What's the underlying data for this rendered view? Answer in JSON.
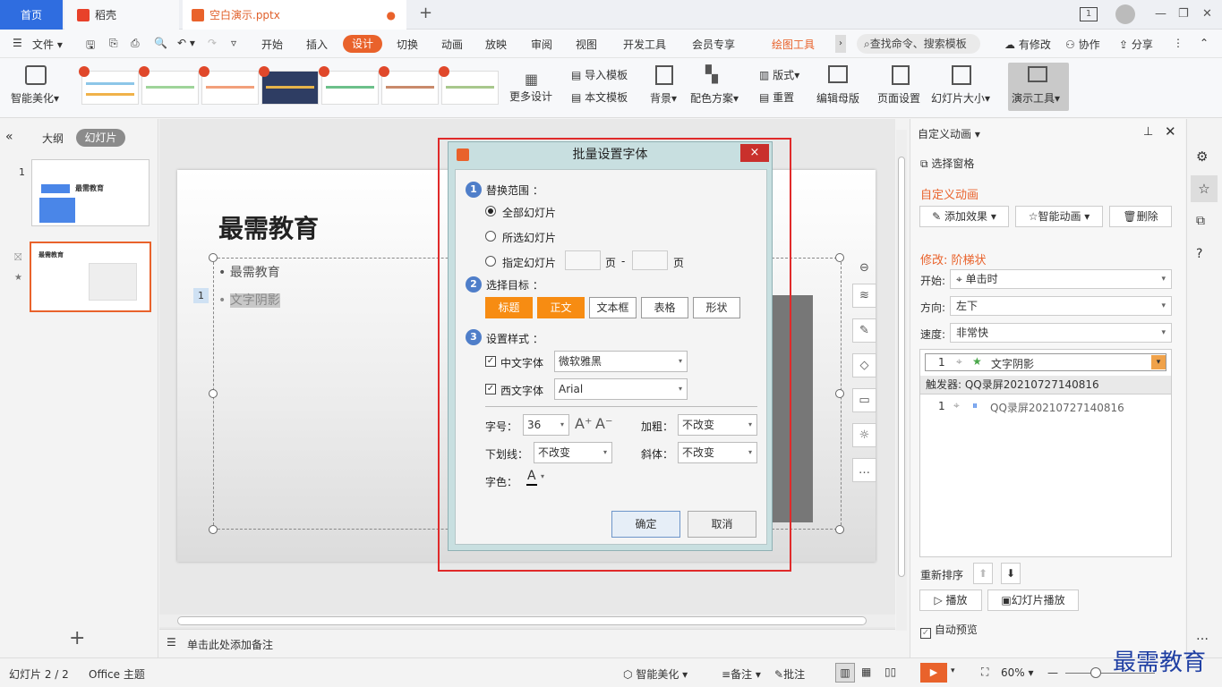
{
  "tabs": {
    "home": "首页",
    "daoke": "稻壳",
    "file": "空白演示.pptx",
    "add": "+"
  },
  "window": {
    "badge": "1"
  },
  "menu": {
    "file": "文件",
    "items": [
      "开始",
      "插入",
      "设计",
      "切换",
      "动画",
      "放映",
      "审阅",
      "视图",
      "开发工具",
      "会员专享"
    ],
    "drawing_tools": "绘图工具",
    "search": "查找命令、搜索模板",
    "modified": "有修改",
    "collab": "协作",
    "share": "分享"
  },
  "ribbon": {
    "smart_beautify": "智能美化",
    "more_design": "更多设计",
    "import_template": "导入模板",
    "this_template": "本文模板",
    "background": "背景",
    "color_scheme": "配色方案",
    "layout": "版式",
    "reset": "重置",
    "edit_master": "编辑母版",
    "page_setup": "页面设置",
    "slide_size": "幻灯片大小",
    "present_tools": "演示工具"
  },
  "left": {
    "outline": "大纲",
    "slides": "幻灯片",
    "slide1_num": "1",
    "slide1_title": "最需教育",
    "slide2_title": "最需教育"
  },
  "slide": {
    "title": "最需教育",
    "bullet1": "最需教育",
    "bullet2": "文字阴影",
    "anim_tag": "1"
  },
  "notes": "单击此处添加备注",
  "dialog": {
    "title": "批量设置字体",
    "close": "×",
    "scope": {
      "num": "1",
      "label": "替换范围 ：",
      "all": "全部幻灯片",
      "selected": "所选幻灯片",
      "specified": "指定幻灯片",
      "page": "页",
      "dash": "-"
    },
    "target": {
      "num": "2",
      "label": "选择目标 ：",
      "items": [
        "标题",
        "正文",
        "文本框",
        "表格",
        "形状"
      ]
    },
    "style": {
      "num": "3",
      "label": "设置样式 ：",
      "cn_font_label": "中文字体",
      "cn_font": "微软雅黑",
      "en_font_label": "西文字体",
      "en_font": "Arial",
      "size_label": "字号：",
      "size": "36",
      "grow": "A⁺",
      "shrink": "A⁻",
      "bold_label": "加粗：",
      "bold": "不改变",
      "underline_label": "下划线：",
      "underline": "不改变",
      "italic_label": "斜体：",
      "italic": "不改变",
      "color_label": "字色："
    },
    "ok": "确定",
    "cancel": "取消"
  },
  "right": {
    "header": "自定义动画",
    "select_pane": "选择窗格",
    "section": "自定义动画",
    "add_effect": "添加效果",
    "smart_anim": "智能动画",
    "delete": "删除",
    "modify": "修改: 阶梯状",
    "start_label": "开始:",
    "start": "单击时",
    "direction_label": "方向:",
    "direction": "左下",
    "speed_label": "速度:",
    "speed": "非常快",
    "item1_num": "1",
    "item1": "文字阴影",
    "trigger": "触发器: QQ录屏20210727140816",
    "item2_num": "1",
    "item2": "QQ录屏20210727140816",
    "reorder": "重新排序",
    "play": "播放",
    "slideshow": "幻灯片播放",
    "autopreview": "自动预览"
  },
  "status": {
    "slide": "幻灯片 2 / 2",
    "theme": "Office 主题",
    "smart": "智能美化",
    "notes": "备注",
    "comments": "批注",
    "zoom": "60%"
  },
  "watermark": "最需教育",
  "colors": {
    "accent": "#e9622b",
    "home_tab": "#2f6de0",
    "target_on": "#f78c12",
    "highlight": "#e02a2a"
  }
}
